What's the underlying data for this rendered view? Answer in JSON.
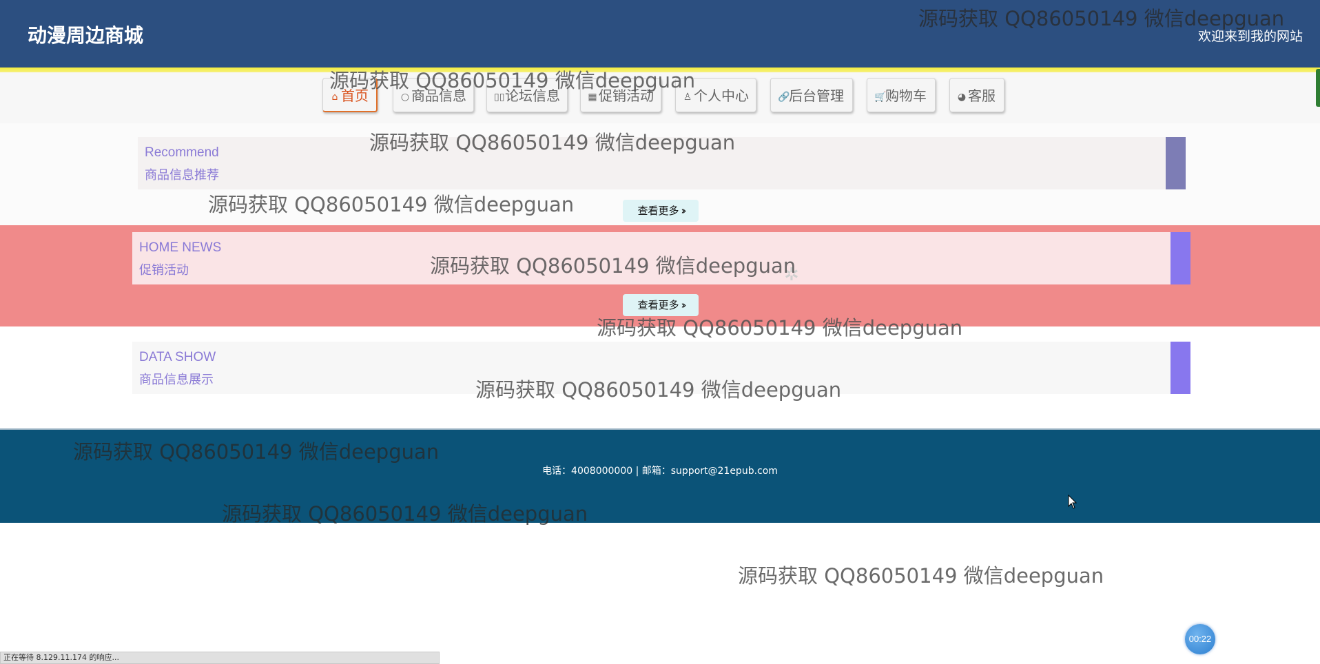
{
  "header": {
    "site_title": "动漫周边商城",
    "welcome_text": "欢迎来到我的网站"
  },
  "nav": {
    "items": [
      {
        "label": "首页",
        "icon": "home-icon",
        "glyph": "⌂",
        "active": true
      },
      {
        "label": "商品信息",
        "icon": "circle-icon",
        "glyph": "○",
        "active": false
      },
      {
        "label": "论坛信息",
        "icon": "forum-icon",
        "glyph": "▯▯",
        "active": false
      },
      {
        "label": "促销活动",
        "icon": "calendar-icon",
        "glyph": "▦",
        "active": false
      },
      {
        "label": "个人中心",
        "icon": "user-icon",
        "glyph": "♙",
        "active": false
      },
      {
        "label": "后台管理",
        "icon": "link-icon",
        "glyph": "🔗",
        "active": false
      },
      {
        "label": "购物车",
        "icon": "cart-icon",
        "glyph": "🛒",
        "active": false
      },
      {
        "label": "客服",
        "icon": "support-icon",
        "glyph": "◕",
        "active": false
      }
    ]
  },
  "sections": {
    "recommend": {
      "title_en": "Recommend",
      "title_zh": "商品信息推荐",
      "more_label": "查看更多"
    },
    "news": {
      "title_en": "HOME NEWS",
      "title_zh": "促销活动",
      "more_label": "查看更多"
    },
    "show": {
      "title_en": "DATA SHOW",
      "title_zh": "商品信息展示"
    }
  },
  "footer": {
    "contact": "电话：4008000000 | 邮箱：support@21epub.com"
  },
  "timer": "00:22",
  "status_bar": "正在等待 8.129.11.174 的响应...",
  "watermark_text": "源码获取 QQ86050149 微信deepguan",
  "colors": {
    "header_bg": "#2c4f80",
    "news_bg": "#f08a8a",
    "footer_bg": "#0b5378",
    "accent_purple": "#8a7ad6",
    "active_nav": "#d9531e"
  }
}
